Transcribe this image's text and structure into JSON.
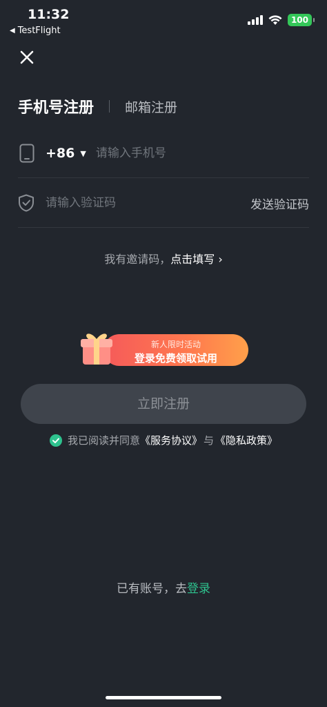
{
  "status_bar": {
    "time": "11:32",
    "back_app": "TestFlight",
    "battery": "100"
  },
  "tabs": {
    "active": "手机号注册",
    "inactive": "邮箱注册"
  },
  "phone": {
    "country_code": "+86",
    "placeholder": "请输入手机号"
  },
  "code": {
    "placeholder": "请输入验证码",
    "send_label": "发送验证码"
  },
  "invite": {
    "prefix": "我有邀请码，",
    "link": "点击填写",
    "chevron": "›"
  },
  "promo": {
    "line1": "新人限时活动",
    "line2": "登录免费领取试用"
  },
  "register_button": "立即注册",
  "agreement": {
    "prefix": "我已阅读并同意",
    "service": "《服务协议》",
    "and": "与",
    "privacy": "《隐私政策》"
  },
  "login": {
    "prefix": "已有账号，去",
    "link": "登录"
  },
  "colors": {
    "background": "#22262d",
    "accent": "#2ec28e",
    "button_bg": "#3f444c"
  }
}
